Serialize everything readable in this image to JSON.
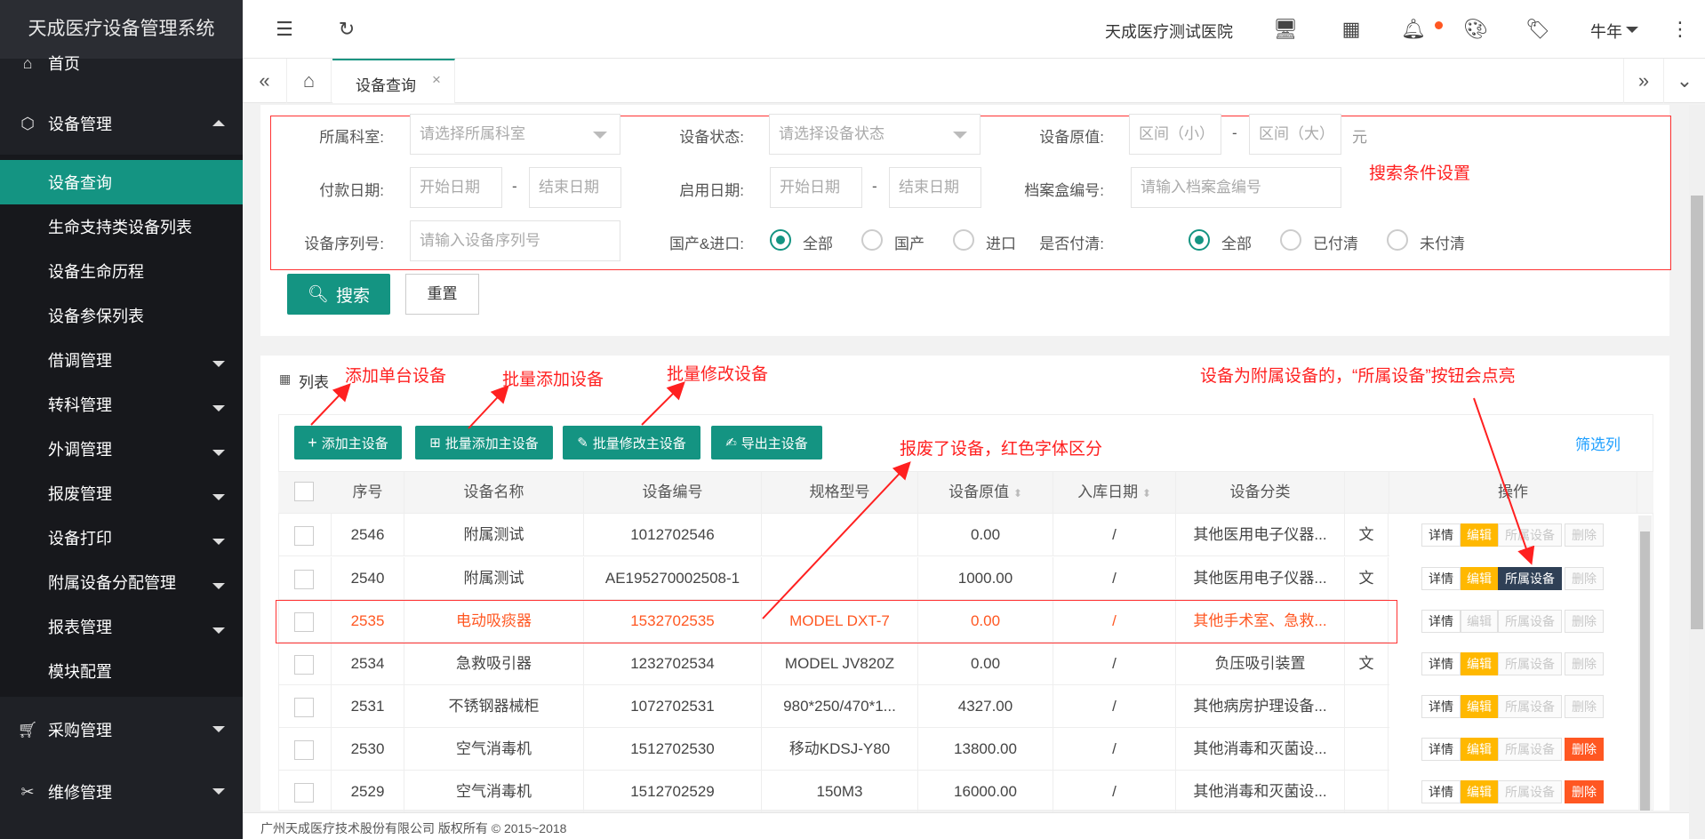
{
  "app_title": "天成医疗设备管理系统",
  "sidebar": {
    "home": "首页",
    "equipment_mgmt": "设备管理",
    "sub_items": [
      "设备查询",
      "生命支持类设备列表",
      "设备生命历程",
      "设备参保列表",
      "借调管理",
      "转科管理",
      "外调管理",
      "报废管理",
      "设备打印",
      "附属设备分配管理",
      "报表管理",
      "模块配置"
    ],
    "purchase": "采购管理",
    "repair": "维修管理"
  },
  "header": {
    "hospital": "天成医疗测试医院",
    "user": "牛年",
    "accent": "#149482"
  },
  "tabs": {
    "active": "设备查询"
  },
  "search": {
    "dept_label": "所属科室:",
    "dept_placeholder": "请选择所属科室",
    "status_label": "设备状态:",
    "status_placeholder": "请选择设备状态",
    "orig_value_label": "设备原值:",
    "orig_min_placeholder": "区间（小）",
    "orig_max_placeholder": "区间（大）",
    "range_dash": "-",
    "unit": "元",
    "pay_date_label": "付款日期:",
    "start_date": "开始日期",
    "end_date": "结束日期",
    "enable_date_label": "启用日期:",
    "archive_label": "档案盒编号:",
    "archive_placeholder": "请输入档案盒编号",
    "serial_label": "设备序列号:",
    "serial_placeholder": "请输入设备序列号",
    "origin_label": "国产&进口:",
    "origin_opts": [
      "全部",
      "国产",
      "进口"
    ],
    "paid_label": "是否付清:",
    "paid_opts": [
      "全部",
      "已付清",
      "未付清"
    ],
    "search_btn": "搜索",
    "reset_btn": "重置"
  },
  "annotations": {
    "search_settings": "搜索条件设置",
    "add_single": "添加单台设备",
    "batch_add": "批量添加设备",
    "batch_edit": "批量修改设备",
    "scrapped": "报废了设备，红色字体区分",
    "attached": "设备为附属设备的，“所属设备”按钮会点亮"
  },
  "list": {
    "title": "列表",
    "add_btn": "添加主设备",
    "batch_add_btn": "批量添加主设备",
    "batch_edit_btn": "批量修改主设备",
    "export_btn": "导出主设备",
    "filter_cols": "筛选列",
    "columns": [
      "序号",
      "设备名称",
      "设备编号",
      "规格型号",
      "设备原值",
      "入库日期",
      "设备分类",
      "操作"
    ],
    "ops": {
      "detail": "详情",
      "edit": "编辑",
      "attach": "所属设备",
      "del": "删除"
    },
    "rows": [
      {
        "id": "2546",
        "name": "附属测试",
        "code": "1012702546",
        "model": "",
        "value": "0.00",
        "date": "/",
        "cat": "其他医用电子仪器...",
        "extra": "文",
        "attach_on": false,
        "del_on": false,
        "scrapped": false
      },
      {
        "id": "2540",
        "name": "附属测试",
        "code": "AE195270002508-1",
        "model": "",
        "value": "1000.00",
        "date": "/",
        "cat": "其他医用电子仪器...",
        "extra": "文",
        "attach_on": true,
        "del_on": false,
        "scrapped": false
      },
      {
        "id": "2535",
        "name": "电动吸痰器",
        "code": "1532702535",
        "model": "MODEL DXT-7",
        "value": "0.00",
        "date": "/",
        "cat": "其他手术室、急救...",
        "extra": "",
        "attach_on": false,
        "del_on": false,
        "scrapped": true
      },
      {
        "id": "2534",
        "name": "急救吸引器",
        "code": "1232702534",
        "model": "MODEL JV820Z",
        "value": "0.00",
        "date": "/",
        "cat": "负压吸引装置",
        "extra": "文",
        "attach_on": false,
        "del_on": false,
        "scrapped": false
      },
      {
        "id": "2531",
        "name": "不锈钢器械柜",
        "code": "1072702531",
        "model": "980*250/470*1...",
        "value": "4327.00",
        "date": "/",
        "cat": "其他病房护理设备...",
        "extra": "",
        "attach_on": false,
        "del_on": false,
        "scrapped": false
      },
      {
        "id": "2530",
        "name": "空气消毒机",
        "code": "1512702530",
        "model": "移动KDSJ-Y80",
        "value": "13800.00",
        "date": "/",
        "cat": "其他消毒和灭菌设...",
        "extra": "",
        "attach_on": false,
        "del_on": true,
        "scrapped": false
      },
      {
        "id": "2529",
        "name": "空气消毒机",
        "code": "1512702529",
        "model": "150M3",
        "value": "16000.00",
        "date": "/",
        "cat": "其他消毒和灭菌设...",
        "extra": "",
        "attach_on": false,
        "del_on": true,
        "scrapped": false
      }
    ]
  },
  "footer": "广州天成医疗技术股份有限公司 版权所有 © 2015~2018"
}
